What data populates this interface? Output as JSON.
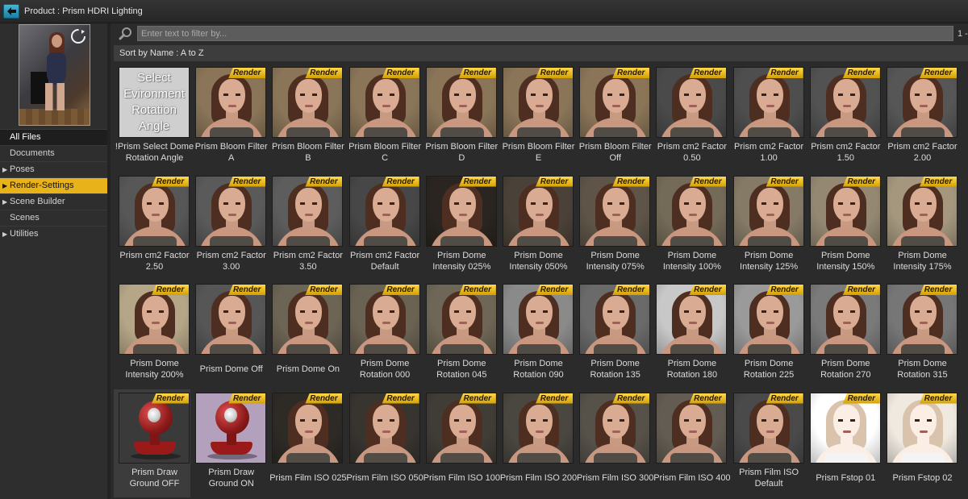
{
  "window": {
    "title": "Product :  Prism HDRI Lighting",
    "back_icon": "back-arrow-icon"
  },
  "sidebar": {
    "refresh_icon": "refresh-icon",
    "items": [
      {
        "label": "All Files",
        "expandable": false,
        "state": "all"
      },
      {
        "label": "Documents",
        "expandable": false,
        "state": ""
      },
      {
        "label": "Poses",
        "expandable": true,
        "state": ""
      },
      {
        "label": "Render-Settings",
        "expandable": true,
        "state": "active"
      },
      {
        "label": "Scene Builder",
        "expandable": true,
        "state": ""
      },
      {
        "label": "Scenes",
        "expandable": false,
        "state": ""
      },
      {
        "label": "Utilities",
        "expandable": true,
        "state": ""
      }
    ]
  },
  "search": {
    "placeholder": "Enter text to filter by...",
    "value": "",
    "page_indicator": "1 -"
  },
  "sort": {
    "label": "Sort by Name : A to Z"
  },
  "colors": {
    "accent": "#e8b21a",
    "badge": "#ffd84a",
    "background": "#2b2b2b"
  },
  "items": [
    {
      "name": "!Prism Select Dome Rotation Angle",
      "lines": [
        "!Prism Select Dome",
        "Rotation Angle"
      ],
      "thumb": "select",
      "thumb_text": [
        "Select",
        "Evironment",
        "Rotation",
        "Angle"
      ],
      "badge": ""
    },
    {
      "name": "Prism Bloom Filter A",
      "lines": [
        "Prism Bloom Filter",
        "A"
      ],
      "thumb": "portrait",
      "bg": "#8a7558",
      "badge": "Render"
    },
    {
      "name": "Prism Bloom Filter B",
      "lines": [
        "Prism Bloom Filter",
        "B"
      ],
      "thumb": "portrait",
      "bg": "#8a7558",
      "badge": "Render"
    },
    {
      "name": "Prism Bloom Filter C",
      "lines": [
        "Prism Bloom Filter",
        "C"
      ],
      "thumb": "portrait",
      "bg": "#8a7558",
      "badge": "Render"
    },
    {
      "name": "Prism Bloom Filter D",
      "lines": [
        "Prism Bloom Filter",
        "D"
      ],
      "thumb": "portrait",
      "bg": "#8a7558",
      "badge": "Render"
    },
    {
      "name": "Prism Bloom Filter E",
      "lines": [
        "Prism Bloom Filter",
        "E"
      ],
      "thumb": "portrait",
      "bg": "#8a7558",
      "badge": "Render"
    },
    {
      "name": "Prism Bloom Filter Off",
      "lines": [
        "Prism Bloom Filter",
        "Off"
      ],
      "thumb": "portrait",
      "bg": "#8a7558",
      "badge": "Render"
    },
    {
      "name": "Prism cm2 Factor 0.50",
      "lines": [
        "Prism cm2 Factor",
        "0.50"
      ],
      "thumb": "portrait",
      "bg": "#4a4a4a",
      "badge": "Render"
    },
    {
      "name": "Prism cm2 Factor 1.00",
      "lines": [
        "Prism cm2 Factor",
        "1.00"
      ],
      "thumb": "portrait",
      "bg": "#4e4e4e",
      "badge": "Render"
    },
    {
      "name": "Prism cm2 Factor 1.50",
      "lines": [
        "Prism cm2 Factor",
        "1.50"
      ],
      "thumb": "portrait",
      "bg": "#525252",
      "badge": "Render"
    },
    {
      "name": "Prism cm2 Factor 2.00",
      "lines": [
        "Prism cm2 Factor",
        "2.00"
      ],
      "thumb": "portrait",
      "bg": "#565656",
      "badge": "Render"
    },
    {
      "name": "Prism cm2 Factor 2.50",
      "lines": [
        "Prism cm2 Factor",
        "2.50"
      ],
      "thumb": "portrait",
      "bg": "#575757",
      "badge": "Render"
    },
    {
      "name": "Prism cm2 Factor 3.00",
      "lines": [
        "Prism cm2 Factor",
        "3.00"
      ],
      "thumb": "portrait",
      "bg": "#5a5a5a",
      "badge": "Render"
    },
    {
      "name": "Prism cm2 Factor 3.50",
      "lines": [
        "Prism cm2 Factor",
        "3.50"
      ],
      "thumb": "portrait",
      "bg": "#5d5d5d",
      "badge": "Render"
    },
    {
      "name": "Prism cm2 Factor Default",
      "lines": [
        "Prism cm2 Factor",
        "Default"
      ],
      "thumb": "portrait",
      "bg": "#474747",
      "badge": "Render"
    },
    {
      "name": "Prism Dome Intensity 025%",
      "lines": [
        "Prism Dome",
        "Intensity 025%"
      ],
      "thumb": "portrait",
      "bg": "#2a2520",
      "badge": "Render"
    },
    {
      "name": "Prism Dome Intensity 050%",
      "lines": [
        "Prism Dome",
        "Intensity 050%"
      ],
      "thumb": "portrait",
      "bg": "#4a4238",
      "badge": "Render"
    },
    {
      "name": "Prism Dome Intensity 075%",
      "lines": [
        "Prism Dome",
        "Intensity 075%"
      ],
      "thumb": "portrait",
      "bg": "#5e5548",
      "badge": "Render"
    },
    {
      "name": "Prism Dome Intensity 100%",
      "lines": [
        "Prism Dome",
        "Intensity 100%"
      ],
      "thumb": "portrait",
      "bg": "#746a58",
      "badge": "Render"
    },
    {
      "name": "Prism Dome Intensity 125%",
      "lines": [
        "Prism Dome",
        "Intensity 125%"
      ],
      "thumb": "portrait",
      "bg": "#857a66",
      "badge": "Render"
    },
    {
      "name": "Prism Dome Intensity 150%",
      "lines": [
        "Prism Dome",
        "Intensity 150%"
      ],
      "thumb": "portrait",
      "bg": "#948872",
      "badge": "Render"
    },
    {
      "name": "Prism Dome Intensity 175%",
      "lines": [
        "Prism Dome",
        "Intensity 175%"
      ],
      "thumb": "portrait",
      "bg": "#a4977e",
      "badge": "Render"
    },
    {
      "name": "Prism Dome Intensity 200%",
      "lines": [
        "Prism Dome",
        "Intensity 200%"
      ],
      "thumb": "portrait",
      "bg": "#b5a687",
      "badge": "Render"
    },
    {
      "name": "Prism Dome Off",
      "lines": [
        "Prism Dome Off"
      ],
      "thumb": "portrait",
      "bg": "#565656",
      "badge": "Render"
    },
    {
      "name": "Prism Dome On",
      "lines": [
        "Prism Dome On"
      ],
      "thumb": "portrait",
      "bg": "#6c6454",
      "badge": "Render"
    },
    {
      "name": "Prism Dome Rotation 000",
      "lines": [
        "Prism Dome",
        "Rotation 000"
      ],
      "thumb": "portrait",
      "bg": "#6a6252",
      "badge": "Render"
    },
    {
      "name": "Prism Dome Rotation 045",
      "lines": [
        "Prism Dome",
        "Rotation 045"
      ],
      "thumb": "portrait",
      "bg": "#6e6656",
      "badge": "Render"
    },
    {
      "name": "Prism Dome Rotation 090",
      "lines": [
        "Prism Dome",
        "Rotation 090"
      ],
      "thumb": "portrait",
      "bg": "#8a8a8a",
      "badge": "Render"
    },
    {
      "name": "Prism Dome Rotation 135",
      "lines": [
        "Prism Dome",
        "Rotation 135"
      ],
      "thumb": "portrait",
      "bg": "#6a6a6a",
      "badge": "Render"
    },
    {
      "name": "Prism Dome Rotation 180",
      "lines": [
        "Prism Dome",
        "Rotation 180"
      ],
      "thumb": "portrait",
      "bg": "#c8c8c8",
      "badge": "Render"
    },
    {
      "name": "Prism Dome Rotation 225",
      "lines": [
        "Prism Dome",
        "Rotation 225"
      ],
      "thumb": "portrait",
      "bg": "#9a9a9a",
      "badge": "Render"
    },
    {
      "name": "Prism Dome Rotation 270",
      "lines": [
        "Prism Dome",
        "Rotation 270"
      ],
      "thumb": "portrait",
      "bg": "#7a7a7a",
      "badge": "Render"
    },
    {
      "name": "Prism Dome Rotation 315",
      "lines": [
        "Prism Dome",
        "Rotation 315"
      ],
      "thumb": "portrait",
      "bg": "#767676",
      "badge": "Render"
    },
    {
      "name": "Prism Draw Ground OFF",
      "lines": [
        "Prism Draw",
        "Ground OFF"
      ],
      "thumb": "drawground",
      "bg": "#3a3a3a",
      "badge": "Render",
      "selected": true
    },
    {
      "name": "Prism Draw Ground ON",
      "lines": [
        "Prism Draw",
        "Ground ON"
      ],
      "thumb": "drawground",
      "bg": "#b3a0bd",
      "badge": "Render"
    },
    {
      "name": "Prism Film ISO 025",
      "lines": [
        "Prism Film ISO 025"
      ],
      "thumb": "portrait",
      "bg": "#2e2a26",
      "badge": "Render"
    },
    {
      "name": "Prism Film ISO 050",
      "lines": [
        "Prism Film ISO 050"
      ],
      "thumb": "portrait",
      "bg": "#383430",
      "badge": "Render"
    },
    {
      "name": "Prism Film ISO 100",
      "lines": [
        "Prism Film ISO 100"
      ],
      "thumb": "portrait",
      "bg": "#403c36",
      "badge": "Render"
    },
    {
      "name": "Prism Film ISO 200",
      "lines": [
        "Prism Film ISO 200"
      ],
      "thumb": "portrait",
      "bg": "#4a4640",
      "badge": "Render"
    },
    {
      "name": "Prism Film ISO 300",
      "lines": [
        "Prism Film ISO 300"
      ],
      "thumb": "portrait",
      "bg": "#56524a",
      "badge": "Render"
    },
    {
      "name": "Prism Film ISO 400",
      "lines": [
        "Prism Film ISO 400"
      ],
      "thumb": "portrait",
      "bg": "#625c52",
      "badge": "Render"
    },
    {
      "name": "Prism Film ISO Default",
      "lines": [
        "Prism Film ISO",
        "Default"
      ],
      "thumb": "portrait",
      "bg": "#4a4a4a",
      "badge": "Render"
    },
    {
      "name": "Prism Fstop 01",
      "lines": [
        "Prism Fstop 01"
      ],
      "thumb": "portrait",
      "bg": "#ffffff",
      "badge": "Render",
      "overexposed": true
    },
    {
      "name": "Prism Fstop 02",
      "lines": [
        "Prism Fstop 02"
      ],
      "thumb": "portrait",
      "bg": "#efe9e0",
      "badge": "Render",
      "overexposed": true
    }
  ]
}
